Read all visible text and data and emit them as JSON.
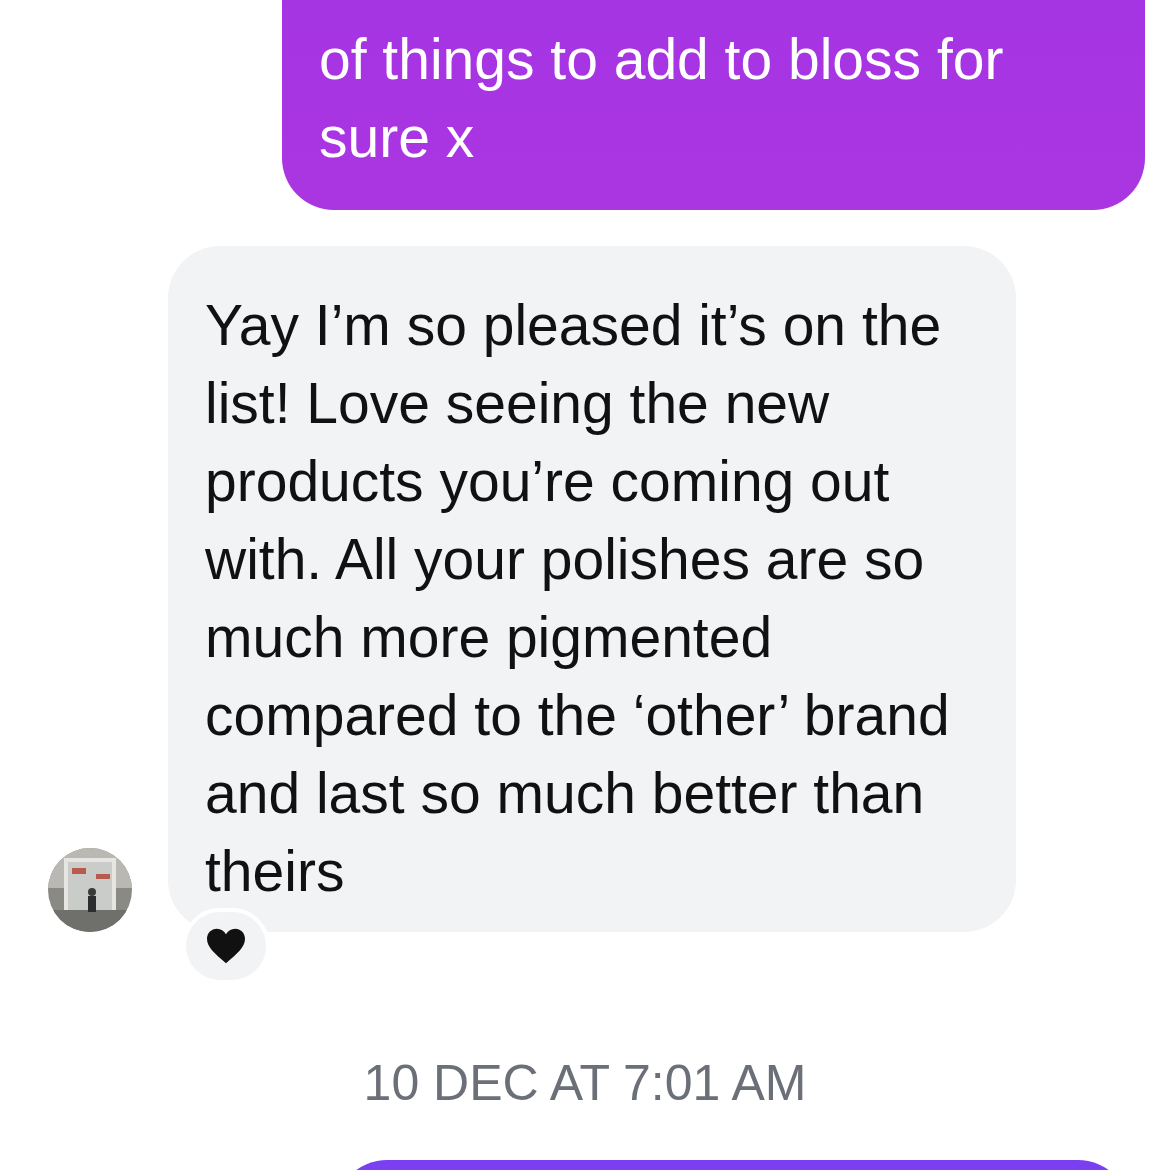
{
  "messages": [
    {
      "kind": "outgoing",
      "text": "of things to add to bloss for sure x"
    },
    {
      "kind": "incoming",
      "text": "Yay I’m so pleased it’s on the list! Love seeing the new products you’re coming out with. All your polishes are so much more pigmented compared to the ‘other’ brand and last so much better than theirs",
      "reacted": true
    },
    {
      "kind": "timestamp",
      "text": "10 DEC AT 7:01 AM"
    },
    {
      "kind": "outgoing"
    }
  ]
}
